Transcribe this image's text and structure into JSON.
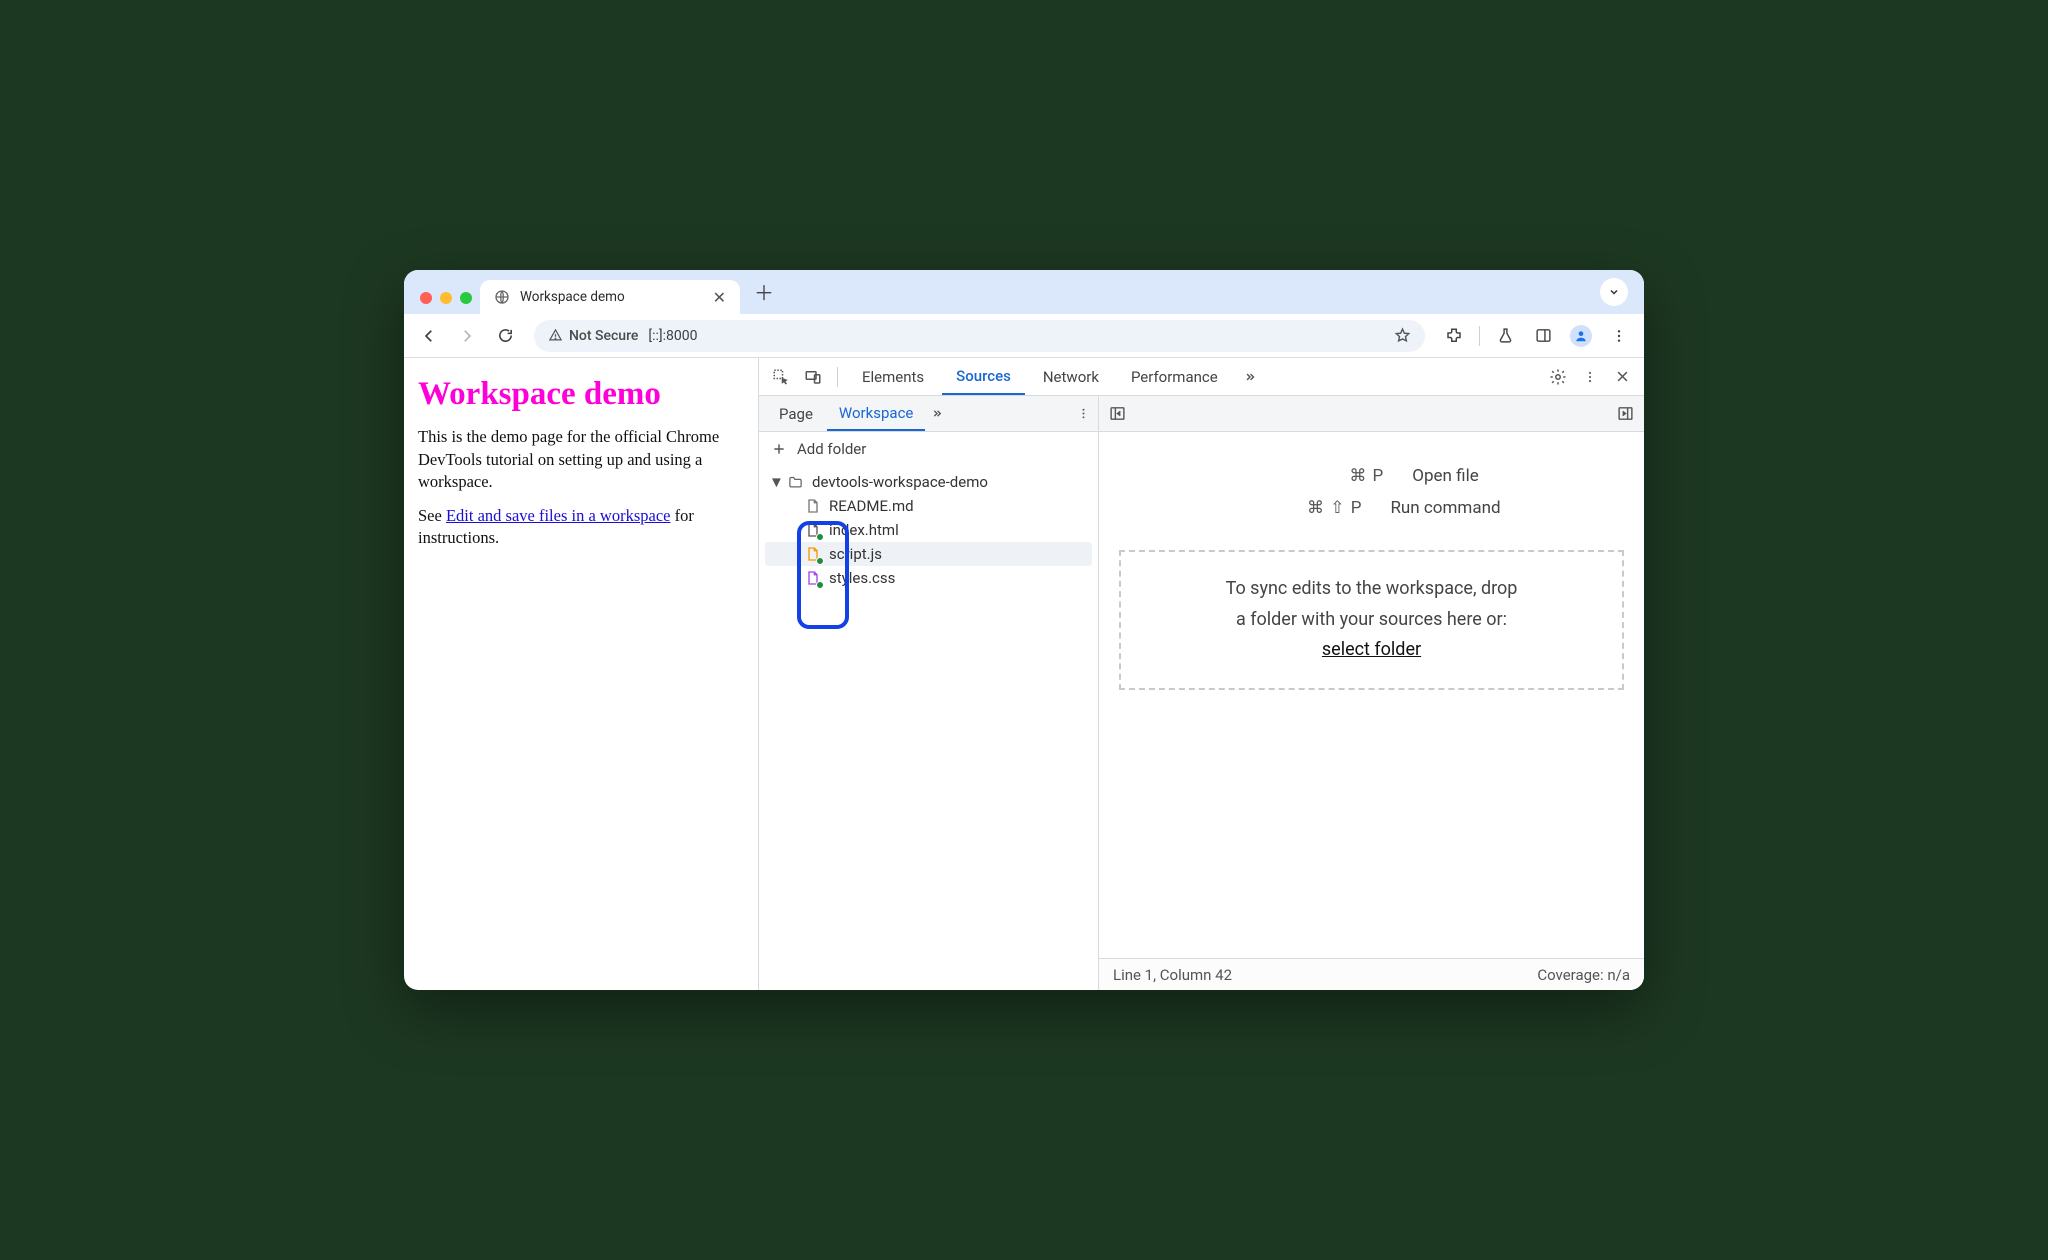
{
  "browser": {
    "tab_title": "Workspace demo",
    "not_secure": "Not Secure",
    "address": "[::]:8000"
  },
  "page": {
    "heading": "Workspace demo",
    "p1": "This is the demo page for the official Chrome DevTools tutorial on setting up and using a workspace.",
    "p2_pre": "See ",
    "p2_link": "Edit and save files in a workspace",
    "p2_post": " for instructions."
  },
  "devtools": {
    "tabs": {
      "elements": "Elements",
      "sources": "Sources",
      "network": "Network",
      "performance": "Performance"
    },
    "subtabs": {
      "page": "Page",
      "workspace": "Workspace"
    },
    "add_folder": "Add folder",
    "tree": {
      "root": "devtools-workspace-demo",
      "files": {
        "readme": "README.md",
        "index": "index.html",
        "script": "script.js",
        "styles": "styles.css"
      }
    },
    "shortcuts": {
      "open_keys": "⌘  P",
      "open_label": "Open file",
      "run_keys": "⌘  ⇧  P",
      "run_label": "Run command"
    },
    "dropzone_line1": "To sync edits to the workspace, drop",
    "dropzone_line2": "a folder with your sources here or:",
    "dropzone_link": "select folder",
    "status_left": "Line 1, Column 42",
    "status_right": "Coverage: n/a"
  }
}
